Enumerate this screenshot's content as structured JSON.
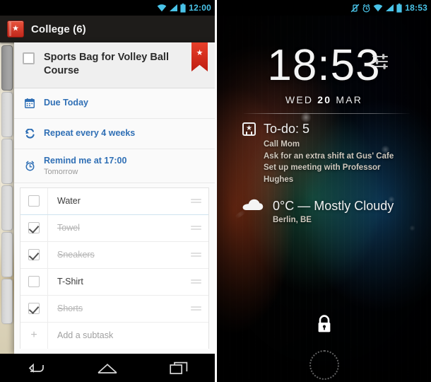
{
  "left_phone": {
    "status_bar": {
      "time": "12:00",
      "icons": [
        "wifi-icon",
        "signal-icon",
        "battery-icon"
      ]
    },
    "app_bar": {
      "icon": "list-book-star-icon",
      "title": "College (6)"
    },
    "task": {
      "checkbox_checked": false,
      "title": "Sports Bag for Volley Ball Course",
      "starred": true,
      "star_glyph": "★"
    },
    "meta": [
      {
        "icon": "calendar-icon",
        "main": "Due Today",
        "sub": ""
      },
      {
        "icon": "repeat-icon",
        "main": "Repeat every 4 weeks",
        "sub": ""
      },
      {
        "icon": "alarm-icon",
        "main": "Remind me at 17:00",
        "sub": "Tomorrow"
      }
    ],
    "subtasks": [
      {
        "label": "Water",
        "done": false
      },
      {
        "label": "Towel",
        "done": true
      },
      {
        "label": "Sneakers",
        "done": true
      },
      {
        "label": "T-Shirt",
        "done": false
      },
      {
        "label": "Shorts",
        "done": true
      }
    ],
    "add_subtask": {
      "plus": "+",
      "label": "Add a subtask"
    },
    "nav_bar": [
      "back-icon",
      "home-icon",
      "recents-icon"
    ]
  },
  "right_phone": {
    "status_bar": {
      "time": "18:53",
      "icons": [
        "vibrate-off-icon",
        "alarm-icon",
        "wifi-icon",
        "signal-icon",
        "battery-icon"
      ]
    },
    "lock_screen": {
      "clock": "18:53",
      "date_weekday": "WED",
      "date_day": "20",
      "date_month": "MAR",
      "sliders_icon": "equalizer-icon"
    },
    "todo_widget": {
      "icon": "list-book-star-icon",
      "title": "To-do: 5",
      "items": [
        "Call Mom",
        "Ask for an extra shift at Gus' Cafe",
        "Set up meeting with Professor",
        "Hughes"
      ]
    },
    "weather_widget": {
      "icon": "cloud-icon",
      "title": "0°C — Mostly Cloudy",
      "location": "Berlin, BE"
    },
    "unlock": {
      "lock_icon": "lock-icon",
      "ring": "dotted-ring"
    }
  },
  "colors": {
    "accent_blue": "#2f6fb5",
    "status_cyan": "#49c3e8",
    "ribbon_red": "#d42a18",
    "appbar_dark": "#1e1c1a"
  }
}
